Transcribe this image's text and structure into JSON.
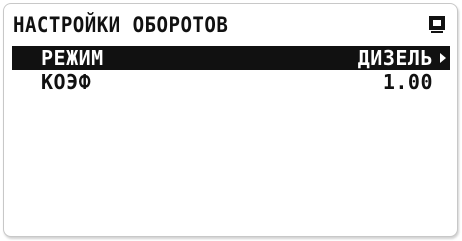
{
  "screen": {
    "title": "НАСТРОЙКИ ОБОРОТОВ",
    "icon": "menu-icon"
  },
  "menu": {
    "items": [
      {
        "label": "РЕЖИМ",
        "value": "ДИЗЕЛЬ",
        "selected": true,
        "has_submenu": true
      },
      {
        "label": "КОЭФ",
        "value": "1.00",
        "selected": false,
        "has_submenu": false
      }
    ]
  },
  "colors": {
    "foreground": "#111111",
    "background": "#ffffff",
    "selection": "#111111",
    "selection_text": "#ffffff"
  }
}
